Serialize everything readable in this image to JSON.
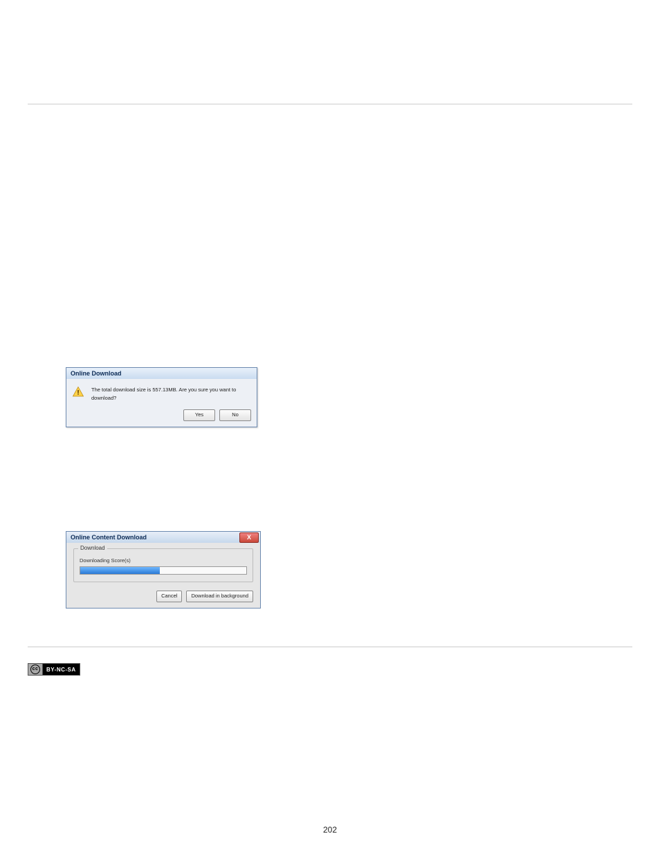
{
  "dialog1": {
    "title": "Online Download",
    "message": "The total download size is 557.13MB. Are you sure you want to download?",
    "yes": "Yes",
    "no": "No"
  },
  "dialog2": {
    "title": "Online Content Download",
    "group_label": "Download",
    "status": "Downloading Score(s)",
    "cancel": "Cancel",
    "background": "Download in background",
    "close": "X"
  },
  "cc": {
    "logo": "cc",
    "label": "BY-NC-SA"
  },
  "page_number": "202"
}
